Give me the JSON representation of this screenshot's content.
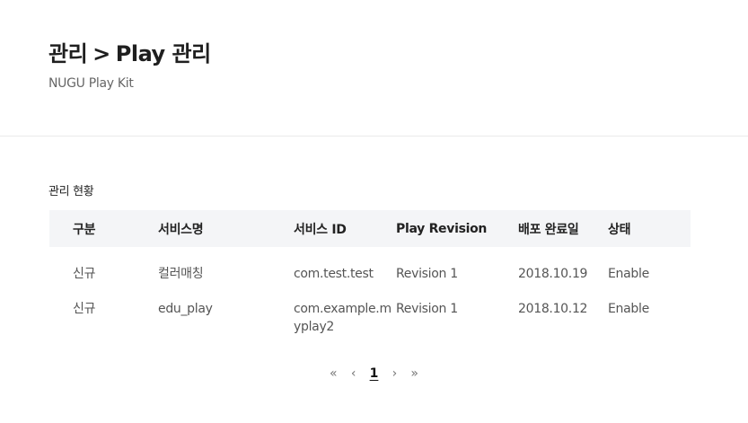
{
  "header": {
    "breadcrumb_parent": "관리",
    "breadcrumb_separator": ">",
    "breadcrumb_current": "Play 관리",
    "subtitle": "NUGU Play Kit"
  },
  "section": {
    "title": "관리 현황"
  },
  "table": {
    "columns": [
      "구분",
      "서비스명",
      "서비스 ID",
      "Play Revision",
      "배포 완료일",
      "상태"
    ],
    "rows": [
      [
        "신규",
        "컬러매칭",
        "com.test.test",
        "Revision 1",
        "2018.10.19",
        "Enable"
      ],
      [
        "신규",
        "edu_play",
        "com.example.myplay2",
        "Revision 1",
        "2018.10.12",
        "Enable"
      ]
    ]
  },
  "pagination": {
    "first": "«",
    "prev": "‹",
    "current_page": "1",
    "next": "›",
    "last": "»"
  }
}
